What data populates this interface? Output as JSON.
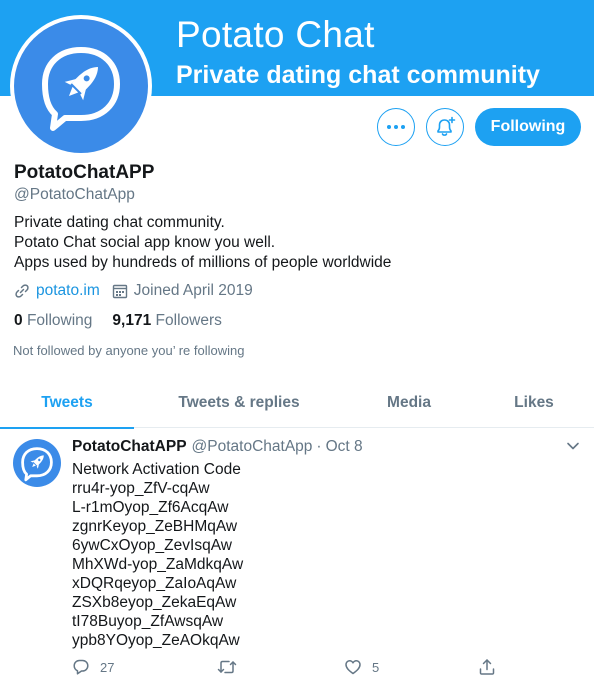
{
  "banner": {
    "title": "Potato Chat",
    "subtitle": "Private dating chat community"
  },
  "profile": {
    "name": "PotatoChatAPP",
    "handle": "@PotatoChatApp",
    "bio": [
      "Private dating chat community.",
      "Potato Chat social app know you well.",
      "Apps used by hundreds of millions of people worldwide"
    ],
    "website": "potato.im",
    "joined": "Joined April 2019",
    "following_count": "0",
    "following_label": "Following",
    "followers_count": "9,171",
    "followers_label": "Followers",
    "not_followed_text": "Not followed by anyone you’ re following"
  },
  "actions": {
    "more_icon": "more-dots-icon",
    "notify_icon": "bell-plus-icon",
    "follow_label": "Following"
  },
  "tabs": [
    {
      "label": "Tweets",
      "active": true
    },
    {
      "label": "Tweets & replies",
      "active": false
    },
    {
      "label": "Media",
      "active": false
    },
    {
      "label": "Likes",
      "active": false
    }
  ],
  "tweet": {
    "name": "PotatoChatAPP",
    "handle": "@PotatoChatApp",
    "separator": "·",
    "date": "Oct 8",
    "lines": [
      "Network Activation Code",
      "rru4r-yop_ZfV-cqAw",
      "L-r1mOyop_Zf6AcqAw",
      "zgnrKeyop_ZeBHMqAw",
      "6ywCxOyop_ZevIsqAw",
      "MhXWd-yop_ZaMdkqAw",
      "xDQRqeyop_ZaIoAqAw",
      "ZSXb8eyop_ZekaEqAw",
      "tI78Buyop_ZfAwsqAw",
      "ypb8YOyop_ZeAOkqAw"
    ],
    "reply_count": "27",
    "retweet_count": "",
    "like_count": "5"
  },
  "colors": {
    "brand": "#1da1f2",
    "avatar_blue": "#3b8be8",
    "secondary_text": "#657786",
    "link": "#1b95e0"
  }
}
